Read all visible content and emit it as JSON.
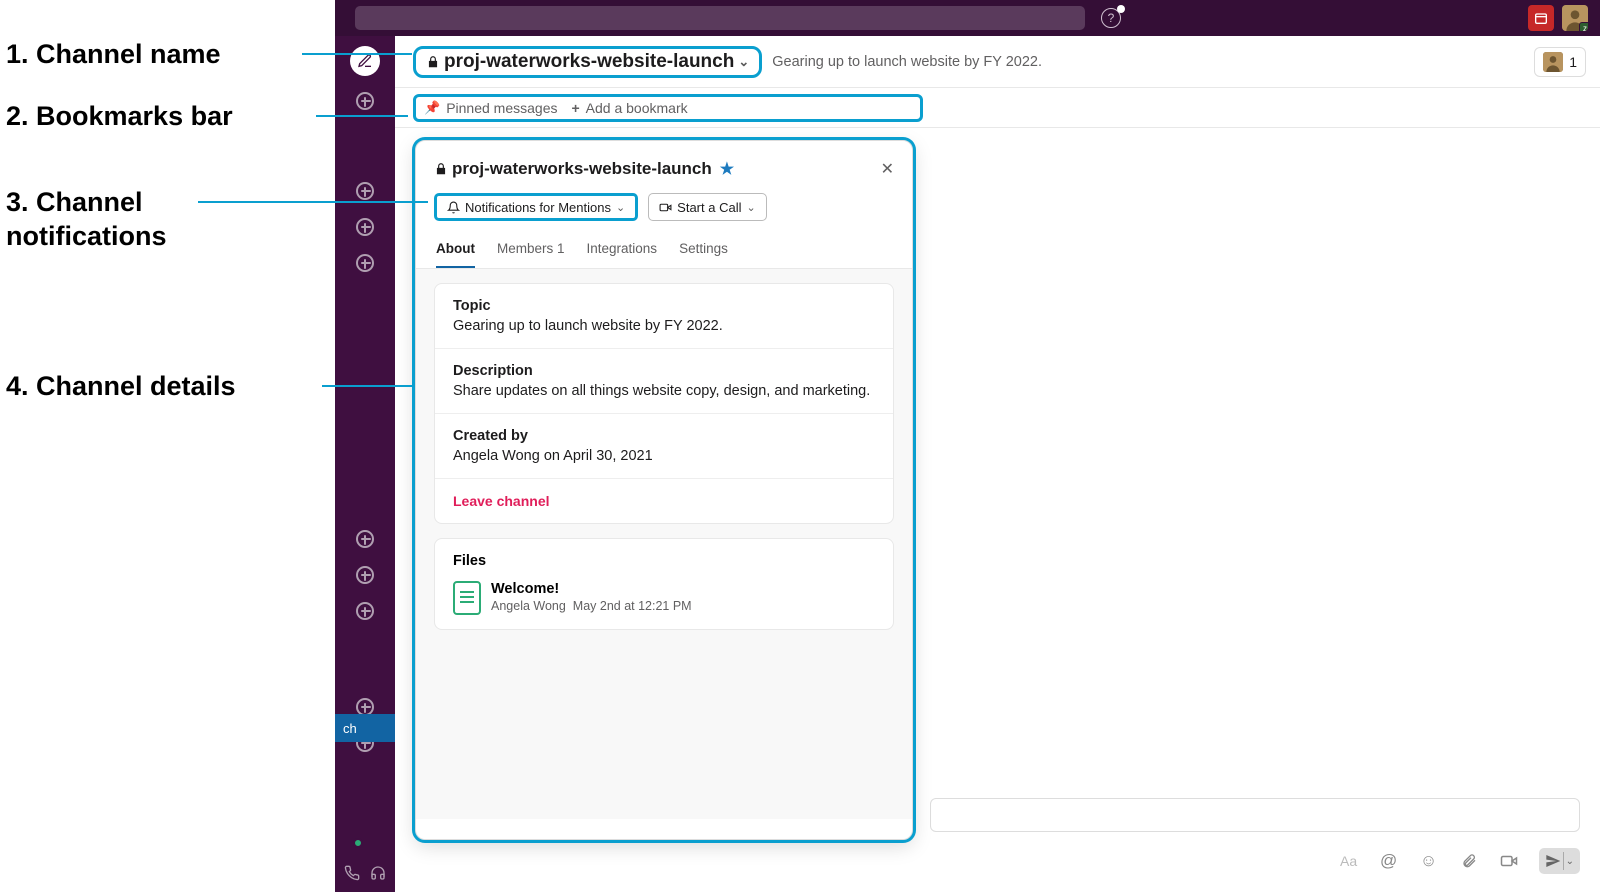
{
  "annotations": {
    "a1": "1. Channel name",
    "a2": "2. Bookmarks bar",
    "a3a": "3. Channel",
    "a3b": "notifications",
    "a4": "4. Channel details"
  },
  "channel": {
    "name": "proj-waterworks-website-launch",
    "topic": "Gearing up to launch website by FY 2022.",
    "member_count": "1"
  },
  "bookmarks": {
    "pinned": "Pinned messages",
    "add": "Add a bookmark"
  },
  "details": {
    "title": "proj-waterworks-website-launch",
    "notif_btn": "Notifications for Mentions",
    "call_btn": "Start a Call",
    "tabs": {
      "about": "About",
      "members": "Members 1",
      "integrations": "Integrations",
      "settings": "Settings"
    },
    "topic_label": "Topic",
    "topic_val": "Gearing up to launch website by FY 2022.",
    "desc_label": "Description",
    "desc_val": "Share updates on all things website copy, design, and marketing.",
    "created_label": "Created by",
    "created_val": "Angela Wong on April 30, 2021",
    "leave": "Leave channel",
    "files_label": "Files",
    "file_name": "Welcome!",
    "file_author": "Angela Wong",
    "file_time": "May 2nd at 12:21 PM"
  },
  "sidebar": {
    "selected_suffix": "ch"
  },
  "composer": {
    "Aa": "Aa"
  }
}
